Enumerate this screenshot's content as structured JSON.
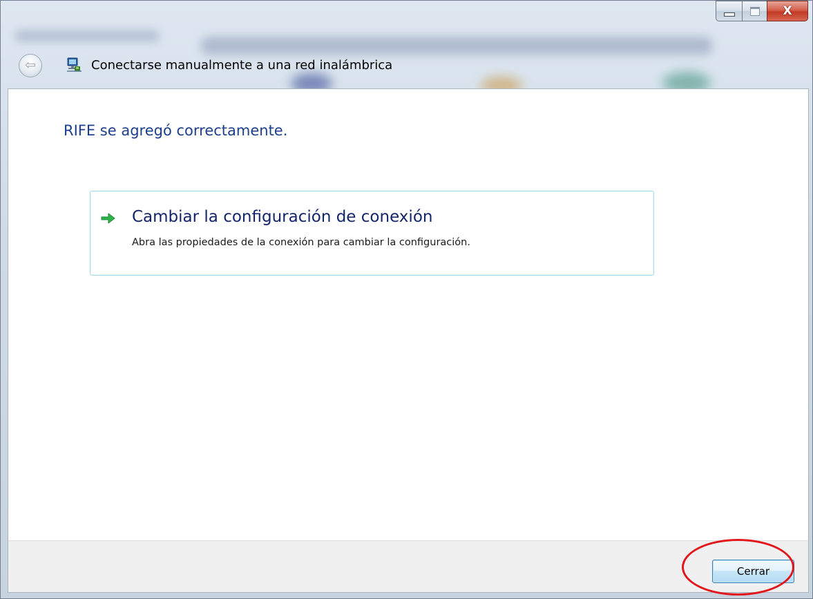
{
  "window": {
    "title": "Conectarse manualmente a una red inalámbrica",
    "caption_buttons": {
      "minimize_icon": "minimize-icon",
      "maximize_icon": "maximize-icon",
      "close_glyph": "X"
    }
  },
  "header": {
    "back_icon": "back-arrow-icon",
    "back_glyph": "⇦",
    "network_icon": "network-connection-icon"
  },
  "main": {
    "heading": "RIFE se agregó correctamente.",
    "command_link": {
      "icon": "green-arrow-icon",
      "title": "Cambiar la configuración de conexión",
      "description": "Abra las propiedades de la conexión para cambiar la configuración."
    }
  },
  "footer": {
    "close_label": "Cerrar"
  },
  "colors": {
    "heading": "#1b3f8e",
    "command_title": "#13256b",
    "command_border": "#a8dde8",
    "annotation": "#e2161b",
    "arrow": "#2fb34a"
  }
}
